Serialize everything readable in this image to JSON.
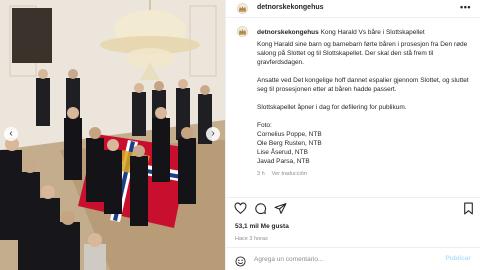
{
  "account": {
    "username": "detnorskekongehus"
  },
  "header": {
    "more_label": "•••"
  },
  "caption": {
    "headline": "Kong Harald Vs båre i Slottskapellet",
    "paragraphs": [
      "Kong Harald sine barn og barnebarn førte båren i prosesjon fra Den røde salong på Slottet og til Slottskapellet. Der skal den stå frem til gravferdsdagen.",
      "Ansatte ved Det kongelige hoff dannet espalier gjennom Slottet, og sluttet seg til prosesjonen etter at båren hadde passert.",
      "Slottskapellet åpner i dag for defilering for publikum."
    ],
    "credits": [
      "Foto:",
      "Cornelius Poppe, NTB",
      "Ole Berg Rusten, NTB",
      "Lise Åserud, NTB",
      "Javad Parsa, NTB"
    ],
    "age": "3 h",
    "translation_label": "Ver traducción"
  },
  "stats": {
    "likes": "53,1 mil Me gusta",
    "posted": "Hace 3 horas"
  },
  "composer": {
    "placeholder": "Agrega un comentario...",
    "publish_label": "Publicar"
  },
  "photo": {
    "nav_prev": "‹",
    "nav_next": "›"
  },
  "colors": {
    "link_blue": "#b2dffc",
    "muted": "#8e8e8e",
    "text": "#262626",
    "flag_red": "#c8102e"
  },
  "icons": [
    "crown-icon",
    "heart-icon",
    "comment-icon",
    "share-icon",
    "bookmark-icon",
    "emoji-icon",
    "chevron-left-icon",
    "chevron-right-icon"
  ]
}
